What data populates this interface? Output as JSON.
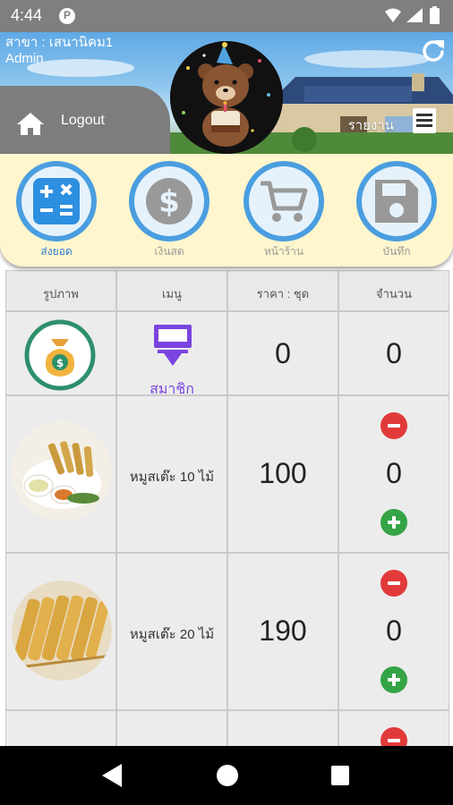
{
  "status_bar": {
    "time": "4:44",
    "notification_letter": "P"
  },
  "header": {
    "branch_line": "สาขา : เสนานิคม1",
    "user_line": "Admin",
    "logout_label": "Logout",
    "report_label": "รายงาน"
  },
  "menu": [
    {
      "label": "ส่งยอด",
      "icon": "calculator-icon",
      "active": true
    },
    {
      "label": "เงินสด",
      "icon": "dollar-icon",
      "active": false
    },
    {
      "label": "หน้าร้าน",
      "icon": "cart-icon",
      "active": false
    },
    {
      "label": "บันทึก",
      "icon": "save-icon",
      "active": false
    }
  ],
  "table": {
    "headers": [
      "รูปภาพ",
      "เมนู",
      "ราคา : ชุด",
      "จำนวน"
    ],
    "member_row": {
      "label": "สมาชิก",
      "price": "0",
      "quantity": "0"
    },
    "rows": [
      {
        "name": "หมูสเต๊ะ 10 ไม้",
        "price": "100",
        "quantity": "0"
      },
      {
        "name": "หมูสเต๊ะ 20 ไม้",
        "price": "190",
        "quantity": "0"
      }
    ]
  },
  "colors": {
    "accent_blue": "#4a9ee0",
    "panel_yellow": "#fff6cd",
    "member_purple": "#7a44e0",
    "minus_red": "#e23a3a",
    "plus_green": "#35a446"
  }
}
